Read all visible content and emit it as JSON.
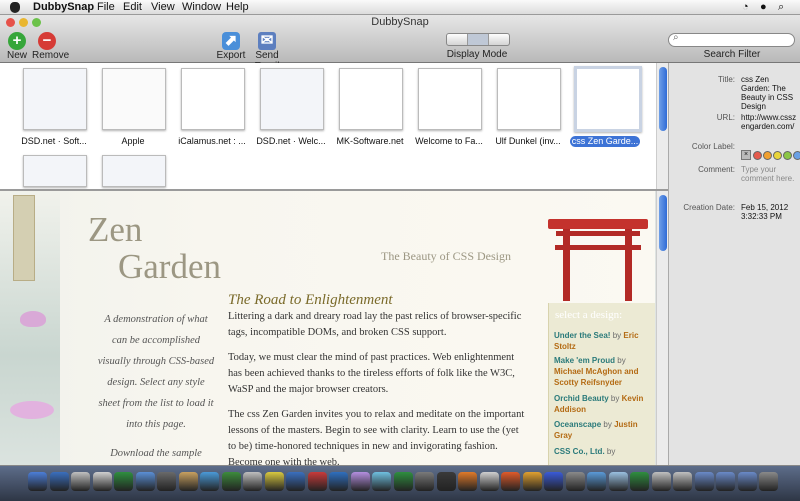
{
  "menubar": {
    "app_name": "DubbySnap",
    "items": [
      "File",
      "Edit",
      "View",
      "Window",
      "Help"
    ]
  },
  "window": {
    "title": "DubbySnap",
    "toolbar": {
      "new_label": "New",
      "remove_label": "Remove",
      "export_label": "Export",
      "send_email_label": "Send Email",
      "display_mode_label": "Display Mode",
      "search_filter_label": "Search Filter",
      "search_placeholder": ""
    }
  },
  "snapshots": [
    {
      "label": "DSD.net · Soft..."
    },
    {
      "label": "Apple"
    },
    {
      "label": "iCalamus.net : ..."
    },
    {
      "label": "DSD.net · Welc..."
    },
    {
      "label": "MK-Software.net"
    },
    {
      "label": "Welcome to Fa..."
    },
    {
      "label": "Ulf Dunkel (inv..."
    },
    {
      "label": "css Zen Garde...",
      "selected": true
    },
    {
      "label": ""
    },
    {
      "label": ""
    }
  ],
  "inspector": {
    "title_label": "Title:",
    "title_value": "css Zen Garden: The Beauty in CSS Design",
    "url_label": "URL:",
    "url_value": "http://www.csszengarden.com/",
    "color_label_label": "Color Label:",
    "comment_label": "Comment:",
    "comment_placeholder": "Type your comment here.",
    "creation_date_label": "Creation Date:",
    "creation_date_value": "Feb 15, 2012",
    "creation_time_value": "3:32:33 PM",
    "color_swatches": [
      "#e55b4d",
      "#f0a030",
      "#e8d43a",
      "#8cc646",
      "#6aa0e6"
    ]
  },
  "preview": {
    "heading_line1": "Zen",
    "heading_line2": "Garden",
    "subtitle": "The Beauty of CSS Design",
    "road_title": "The Road to Enlightenment",
    "para1": "Littering a dark and dreary road lay the past relics of browser-specific tags, incompatible DOMs, and broken CSS support.",
    "para2": "Today, we must clear the mind of past practices. Web enlightenment has been achieved thanks to the tireless efforts of folk like the W3C, WaSP and the major browser creators.",
    "para3": "The css Zen Garden invites you to relax and meditate on the important lessons of the masters. Begin to see with clarity. Learn to use the (yet to be) time-honored techniques in new and invigorating fashion. Become one with the web.",
    "side_text": "A demonstration of what can be accomplished visually through CSS-based design. Select any style sheet from the list to load it into this page.",
    "side_download": "Download the sample",
    "select_design": "select a design:",
    "designs": [
      {
        "name": "Under the Sea!",
        "by": "by",
        "author": "Eric Stoltz"
      },
      {
        "name": "Make 'em Proud",
        "by": "by",
        "author": "Michael McAghon and Scotty Reifsnyder"
      },
      {
        "name": "Orchid Beauty",
        "by": "by",
        "author": "Kevin Addison"
      },
      {
        "name": "Oceanscape",
        "by": "by",
        "author": "Justin Gray"
      },
      {
        "name": "CSS Co., Ltd.",
        "by": "by",
        "author": ""
      }
    ]
  }
}
